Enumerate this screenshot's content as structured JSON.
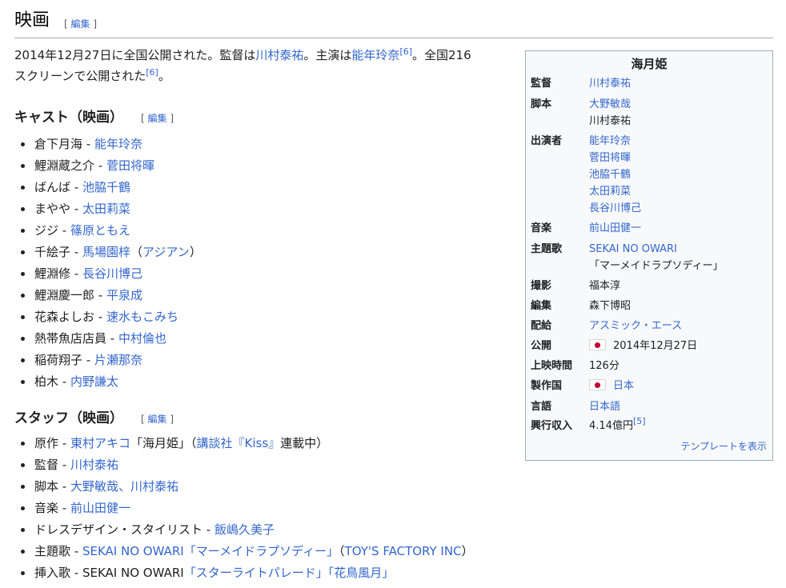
{
  "heading": {
    "title": "映画",
    "edit_label": "編集",
    "bracket_open": "[",
    "bracket_close": "]"
  },
  "intro": {
    "t1": "2014年12月27日に全国公開された。監督は",
    "director_link": "川村泰祐",
    "t2": "。主演は",
    "star_link": "能年玲奈",
    "ref1": "[6]",
    "t3": "。全国216",
    "t4": "スクリーンで公開された",
    "ref2": "[6]",
    "t5": "。"
  },
  "cast_section": {
    "title": "キャスト（映画）",
    "edit_label": "編集",
    "items": [
      {
        "role": "倉下月海",
        "sep": " - ",
        "actor": "能年玲奈"
      },
      {
        "role": "鯉淵蔵之介",
        "sep": " - ",
        "actor": "菅田将暉"
      },
      {
        "role": "ばんば",
        "sep": " - ",
        "actor": "池脇千鶴"
      },
      {
        "role": "まやや",
        "sep": " - ",
        "actor": "太田莉菜"
      },
      {
        "role": "ジジ",
        "sep": " - ",
        "actor": "篠原ともえ"
      },
      {
        "role": "千絵子",
        "sep": " - ",
        "actor": "馬場園梓",
        "extra_open": "（",
        "extra_link": "アジアン",
        "extra_close": "）"
      },
      {
        "role": "鯉淵修",
        "sep": " - ",
        "actor": "長谷川博己"
      },
      {
        "role": "鯉淵慶一郎",
        "sep": " - ",
        "actor": "平泉成"
      },
      {
        "role": "花森よしお",
        "sep": " - ",
        "actor": "速水もこみち"
      },
      {
        "role": "熱帯魚店店員",
        "sep": " - ",
        "actor": "中村倫也"
      },
      {
        "role": "稲荷翔子",
        "sep": " - ",
        "actor": "片瀬那奈"
      },
      {
        "role": "柏木",
        "sep": " - ",
        "actor": "内野謙太"
      }
    ]
  },
  "staff_section": {
    "title": "スタッフ（映画）",
    "edit_label": "編集",
    "items": {
      "original": {
        "label": "原作",
        "sep": " - ",
        "author": "東村アキコ",
        "work": "「海月姫」",
        "open": "（",
        "publisher": "講談社",
        "magazine": "『Kiss』",
        "tail": "連載中）"
      },
      "director": {
        "label": "監督",
        "sep": " - ",
        "name": "川村泰祐"
      },
      "writer": {
        "label": "脚本",
        "sep": " - ",
        "name1": "大野敏哉",
        "comma": "、",
        "name2": "川村泰祐"
      },
      "music": {
        "label": "音楽",
        "sep": " - ",
        "name": "前山田健一"
      },
      "dress": {
        "label": "ドレスデザイン・スタイリスト",
        "sep": " - ",
        "name": "飯嶋久美子"
      },
      "theme": {
        "label": "主題歌",
        "sep": " - ",
        "artist": "SEKAI NO OWARI",
        "song": "「マーメイドラプソディー」",
        "open": "（",
        "label_co": "TOY'S FACTORY INC",
        "close": "）"
      },
      "insert": {
        "label": "挿入歌",
        "sep": " - ",
        "artist": "SEKAI NO OWARI",
        "song1": "「スターライトパレード」",
        "song2": "「花鳥風月」"
      }
    }
  },
  "infobox": {
    "title": "海月姫",
    "director_label": "監督",
    "director": "川村泰祐",
    "writer_label": "脚本",
    "writer1": "大野敏哉",
    "writer2": "川村泰祐",
    "cast_label": "出演者",
    "cast": [
      "能年玲奈",
      "菅田将暉",
      "池脇千鶴",
      "太田莉菜",
      "長谷川博己"
    ],
    "music_label": "音楽",
    "music": "前山田健一",
    "theme_label": "主題歌",
    "theme_artist": "SEKAI NO OWARI",
    "theme_song": "「マーメイドラプソディー」",
    "camera_label": "撮影",
    "camera": "福本淳",
    "editing_label": "編集",
    "editing": "森下博昭",
    "distribution_label": "配給",
    "distribution": "アスミック・エース",
    "release_label": "公開",
    "release": "2014年12月27日",
    "runtime_label": "上映時間",
    "runtime": "126分",
    "country_label": "製作国",
    "country": "日本",
    "language_label": "言語",
    "language": "日本語",
    "boxoffice_label": "興行収入",
    "boxoffice": "4.14億円",
    "boxoffice_ref": "[5]",
    "footer_link": "テンプレートを表示",
    "flag_color": "#bc002d"
  },
  "colors": {
    "link": "#3366cc",
    "text": "#202122",
    "infobox_bg": "#f8f9fa",
    "border": "#a2a9b1"
  }
}
